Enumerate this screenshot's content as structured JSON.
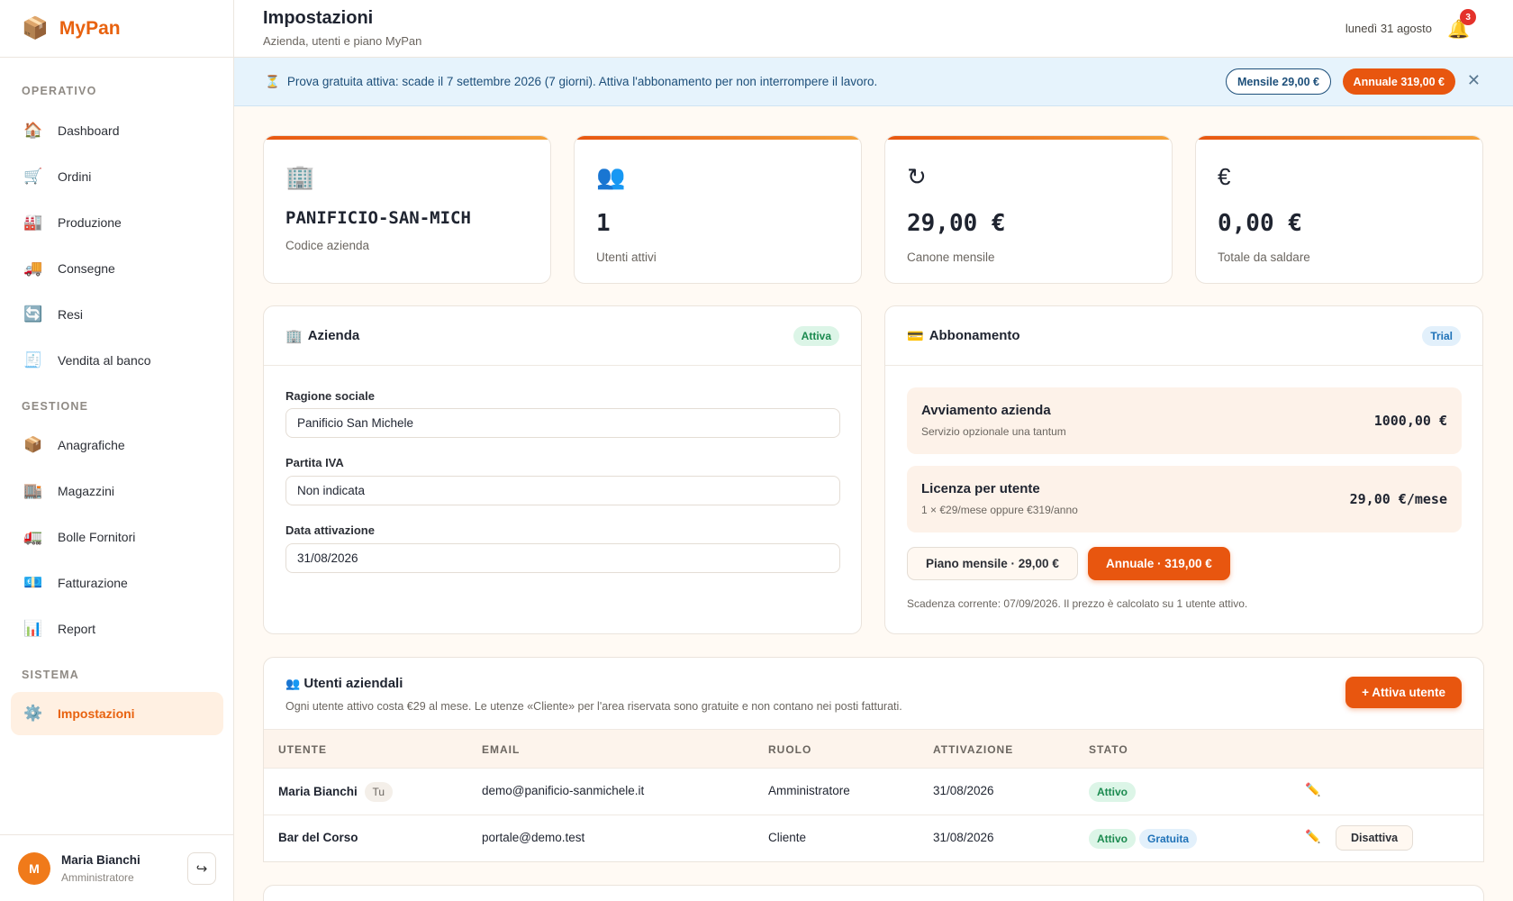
{
  "brand": {
    "name": "MyPan",
    "logo_icon": "📦"
  },
  "sidebar": {
    "sections": {
      "operativo": "OPERATIVO",
      "gestione": "GESTIONE",
      "sistema": "SISTEMA"
    },
    "items": [
      {
        "label": "Dashboard",
        "icon": "🏠"
      },
      {
        "label": "Ordini",
        "icon": "🛒"
      },
      {
        "label": "Produzione",
        "icon": "🏭"
      },
      {
        "label": "Consegne",
        "icon": "🚚"
      },
      {
        "label": "Resi",
        "icon": "🔄"
      },
      {
        "label": "Vendita al banco",
        "icon": "🧾"
      },
      {
        "label": "Anagrafiche",
        "icon": "📦"
      },
      {
        "label": "Magazzini",
        "icon": "🏬"
      },
      {
        "label": "Bolle Fornitori",
        "icon": "🚛"
      },
      {
        "label": "Fatturazione",
        "icon": "💶"
      },
      {
        "label": "Report",
        "icon": "📊"
      },
      {
        "label": "Impostazioni",
        "icon": "⚙️"
      }
    ],
    "user": {
      "initial": "M",
      "name": "Maria Bianchi",
      "role": "Amministratore",
      "logout_icon": "↪"
    }
  },
  "header": {
    "title": "Impostazioni",
    "subtitle": "Azienda, utenti e piano MyPan",
    "date": "lunedì 31 agosto",
    "notifications": "3"
  },
  "trial": {
    "text": "Prova gratuita attiva: scade il 7 settembre 2026 (7 giorni). Attiva l'abbonamento per non interrompere il lavoro.",
    "monthly": "Mensile 29,00 €",
    "annual": "Annuale 319,00 €",
    "close": "✕"
  },
  "stats": [
    {
      "icon": "🏢",
      "value": "PANIFICIO-SAN-MICH",
      "label": "Codice azienda"
    },
    {
      "icon": "👥",
      "value": "1",
      "label": "Utenti attivi"
    },
    {
      "icon": "↻",
      "value": "29,00 €",
      "label": "Canone mensile"
    },
    {
      "icon": "€",
      "value": "0,00 €",
      "label": "Totale da saldare"
    }
  ],
  "azienda": {
    "title": "Azienda",
    "status": "Attiva",
    "fields": [
      {
        "label": "Ragione sociale",
        "value": "Panificio San Michele"
      },
      {
        "label": "Partita IVA",
        "value": "Non indicata"
      },
      {
        "label": "Data attivazione",
        "value": "31/08/2026"
      }
    ]
  },
  "abbonamento": {
    "title": "Abbonamento",
    "status": "Trial",
    "items": [
      {
        "title": "Avviamento azienda",
        "desc": "Servizio opzionale una tantum",
        "price": "1000,00 €"
      },
      {
        "title": "Licenza per utente",
        "desc": "1 × €29/mese oppure €319/anno",
        "price": "29,00 €/mese"
      }
    ],
    "monthly_btn": "Piano mensile · 29,00 €",
    "annual_btn": "Annuale · 319,00 €",
    "note": "Scadenza corrente: 07/09/2026. Il prezzo è calcolato su 1 utente attivo."
  },
  "users": {
    "title": "Utenti aziendali",
    "desc": "Ogni utente attivo costa €29 al mese. Le utenze «Cliente» per l'area riservata sono gratuite e non contano nei posti fatturati.",
    "add_btn": "+ Attiva utente",
    "columns": [
      "UTENTE",
      "EMAIL",
      "RUOLO",
      "ATTIVAZIONE",
      "STATO"
    ],
    "rows": [
      {
        "name": "Maria Bianchi",
        "you": "Tu",
        "email": "demo@panificio-sanmichele.it",
        "role": "Amministratore",
        "date": "31/08/2026",
        "status": "Attivo"
      },
      {
        "name": "Bar del Corso",
        "email": "portale@demo.test",
        "role": "Cliente",
        "date": "31/08/2026",
        "status": "Attivo",
        "extra": "Gratuita",
        "action": "Disattiva"
      }
    ]
  }
}
